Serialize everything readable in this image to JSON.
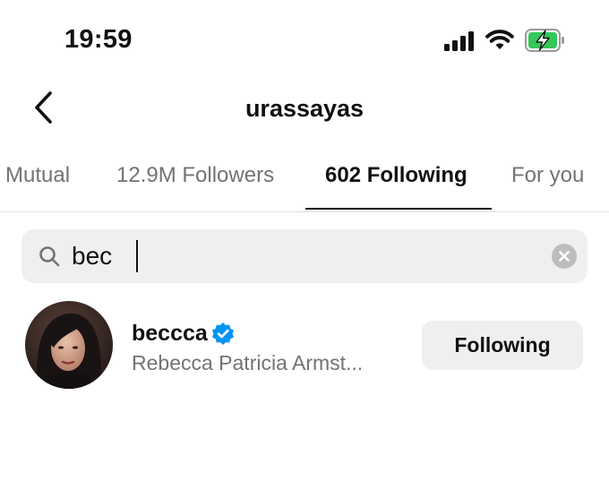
{
  "status_bar": {
    "time": "19:59",
    "icons": [
      "cellular-signal-icon",
      "wifi-icon",
      "battery-charging-icon"
    ],
    "battery_color": "#34c759"
  },
  "header": {
    "back_icon": "chevron-left-icon",
    "title": "urassayas"
  },
  "tabs": [
    {
      "label": "Mutual",
      "active": false
    },
    {
      "label": "12.9M Followers",
      "active": false
    },
    {
      "label": "602 Following",
      "active": true
    },
    {
      "label": "For you",
      "active": false
    }
  ],
  "search": {
    "value": "bec",
    "search_icon": "search-icon",
    "clear_icon": "clear-icon"
  },
  "results": [
    {
      "username": "beccca",
      "verified": true,
      "verified_color": "#0095f6",
      "full_name": "Rebecca Patricia Armst...",
      "button_label": "Following"
    }
  ]
}
